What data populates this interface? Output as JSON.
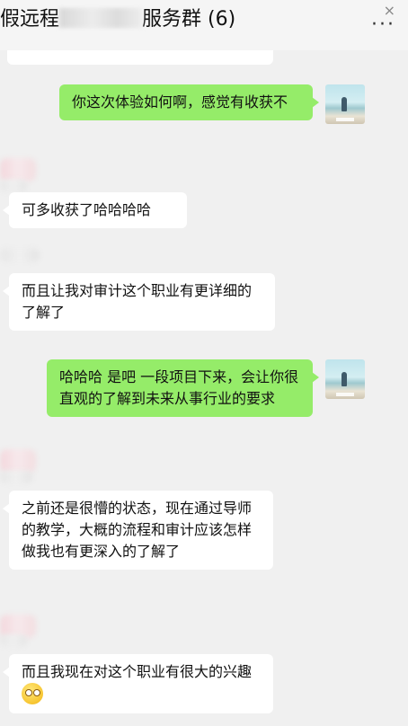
{
  "header": {
    "title_prefix": "假远程",
    "title_suffix": "服务群 (6)",
    "close_glyph": "×",
    "more_glyph": "···"
  },
  "messages": [
    {
      "sender": "me",
      "text": "你这次体验如何啊，感觉有收获不"
    },
    {
      "sender": "other",
      "text": "可多收获了哈哈哈哈"
    },
    {
      "sender": "other",
      "text": "而且让我对审计这个职业有更详细的了解了"
    },
    {
      "sender": "me",
      "text": "哈哈哈 是吧 一段项目下来，会让你很直观的了解到未来从事行业的要求"
    },
    {
      "sender": "other",
      "text": "之前还是很懵的状态，现在通过导师的教学，大概的流程和审计应该怎样做我也有更深入的了解了"
    },
    {
      "sender": "other",
      "text": "而且我现在对这个职业有很大的兴趣",
      "emoji": "blush-emoji"
    }
  ],
  "colors": {
    "background": "#f0f0f0",
    "my_bubble": "#95ec69",
    "other_bubble": "#ffffff"
  }
}
